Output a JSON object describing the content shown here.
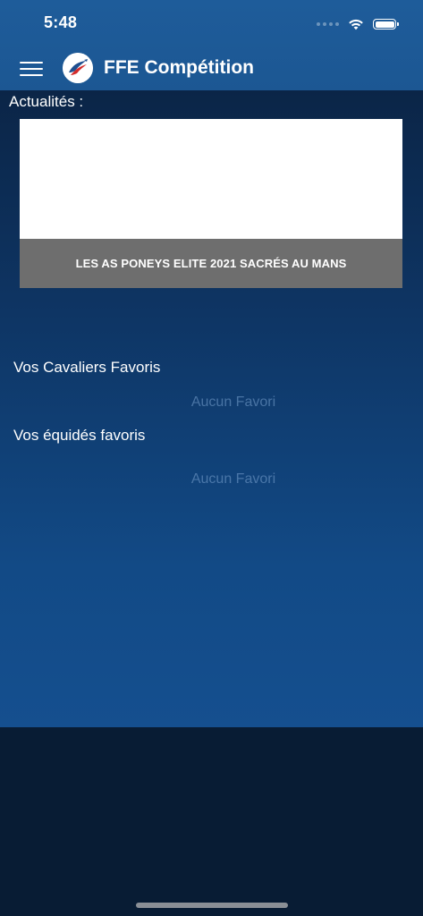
{
  "status_bar": {
    "time": "5:48"
  },
  "nav": {
    "title": "FFE Compétition",
    "logo_icon": "ffe-horse-logo-icon",
    "menu_icon": "hamburger-menu-icon"
  },
  "news": {
    "section_title": "Actualités :",
    "items": [
      {
        "caption": "LES AS PONEYS ELITE 2021 SACRÉS AU MANS"
      }
    ]
  },
  "favorites": {
    "riders": {
      "title": "Vos Cavaliers Favoris",
      "empty_text": "Aucun Favori"
    },
    "horses": {
      "title": "Vos équidés favoris",
      "empty_text": "Aucun Favori"
    }
  },
  "colors": {
    "nav_background": "#1e5c9a",
    "caption_background": "#6e6e6e",
    "screen_background": "#081c34"
  }
}
